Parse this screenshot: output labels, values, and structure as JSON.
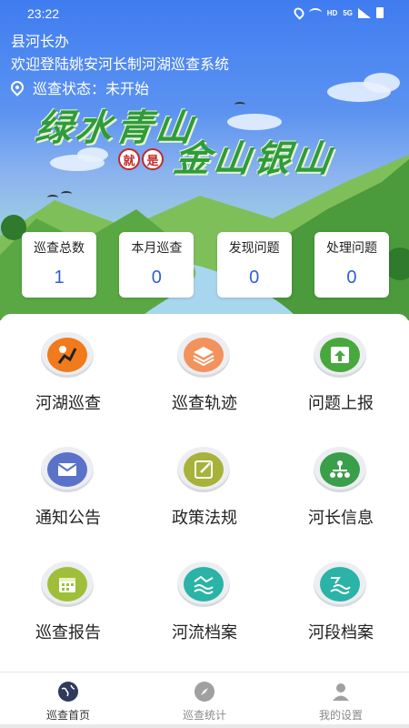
{
  "status_bar": {
    "time": "23:22",
    "network": "HD",
    "signal": "5G"
  },
  "header": {
    "title": "县河长办",
    "welcome": "欢迎登陆姚安河长制河湖巡查系统",
    "patrol_state": "巡查状态：未开始"
  },
  "banner": {
    "slogan_part1": "绿水青山",
    "seal_char1": "就",
    "seal_char2": "是",
    "slogan_part2": "金山银山"
  },
  "stats": [
    {
      "label": "巡查总数",
      "value": "1"
    },
    {
      "label": "本月巡查",
      "value": "0"
    },
    {
      "label": "发现问题",
      "value": "0"
    },
    {
      "label": "处理问题",
      "value": "0"
    }
  ],
  "grid": [
    {
      "label": "河湖巡查",
      "icon": "patrol-route-icon",
      "color": "#f07a1c"
    },
    {
      "label": "巡查轨迹",
      "icon": "layers-icon",
      "color": "#f2925c"
    },
    {
      "label": "问题上报",
      "icon": "upload-icon",
      "color": "#48a83e"
    },
    {
      "label": "通知公告",
      "icon": "mail-icon",
      "color": "#5b72c9"
    },
    {
      "label": "政策法规",
      "icon": "edit-doc-icon",
      "color": "#a6b23a"
    },
    {
      "label": "河长信息",
      "icon": "org-chart-icon",
      "color": "#3a9e4a"
    },
    {
      "label": "巡查报告",
      "icon": "calendar-icon",
      "color": "#9fbf3a"
    },
    {
      "label": "河流档案",
      "icon": "river-icon",
      "color": "#2ab3a6"
    },
    {
      "label": "河段档案",
      "icon": "river-section-icon",
      "color": "#2ab3a6"
    }
  ],
  "bottom_nav": [
    {
      "label": "巡查首页",
      "icon": "globe-icon",
      "active": true
    },
    {
      "label": "巡查统计",
      "icon": "compass-icon",
      "active": false
    },
    {
      "label": "我的设置",
      "icon": "user-icon",
      "active": false
    }
  ],
  "colors": {
    "primary": "#3f7cf0",
    "stat_value": "#2f5fd6",
    "slogan": "#2f9b3c"
  }
}
